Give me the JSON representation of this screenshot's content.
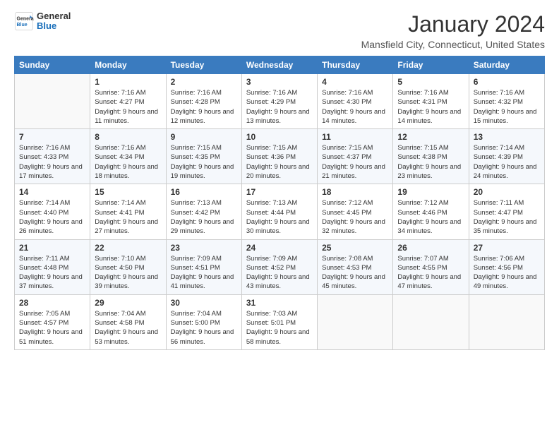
{
  "header": {
    "logo_general": "General",
    "logo_blue": "Blue",
    "month_title": "January 2024",
    "location": "Mansfield City, Connecticut, United States"
  },
  "days_of_week": [
    "Sunday",
    "Monday",
    "Tuesday",
    "Wednesday",
    "Thursday",
    "Friday",
    "Saturday"
  ],
  "weeks": [
    [
      {
        "day": "",
        "sunrise": "",
        "sunset": "",
        "daylight": ""
      },
      {
        "day": "1",
        "sunrise": "Sunrise: 7:16 AM",
        "sunset": "Sunset: 4:27 PM",
        "daylight": "Daylight: 9 hours and 11 minutes."
      },
      {
        "day": "2",
        "sunrise": "Sunrise: 7:16 AM",
        "sunset": "Sunset: 4:28 PM",
        "daylight": "Daylight: 9 hours and 12 minutes."
      },
      {
        "day": "3",
        "sunrise": "Sunrise: 7:16 AM",
        "sunset": "Sunset: 4:29 PM",
        "daylight": "Daylight: 9 hours and 13 minutes."
      },
      {
        "day": "4",
        "sunrise": "Sunrise: 7:16 AM",
        "sunset": "Sunset: 4:30 PM",
        "daylight": "Daylight: 9 hours and 14 minutes."
      },
      {
        "day": "5",
        "sunrise": "Sunrise: 7:16 AM",
        "sunset": "Sunset: 4:31 PM",
        "daylight": "Daylight: 9 hours and 14 minutes."
      },
      {
        "day": "6",
        "sunrise": "Sunrise: 7:16 AM",
        "sunset": "Sunset: 4:32 PM",
        "daylight": "Daylight: 9 hours and 15 minutes."
      }
    ],
    [
      {
        "day": "7",
        "sunrise": "Sunrise: 7:16 AM",
        "sunset": "Sunset: 4:33 PM",
        "daylight": "Daylight: 9 hours and 17 minutes."
      },
      {
        "day": "8",
        "sunrise": "Sunrise: 7:16 AM",
        "sunset": "Sunset: 4:34 PM",
        "daylight": "Daylight: 9 hours and 18 minutes."
      },
      {
        "day": "9",
        "sunrise": "Sunrise: 7:15 AM",
        "sunset": "Sunset: 4:35 PM",
        "daylight": "Daylight: 9 hours and 19 minutes."
      },
      {
        "day": "10",
        "sunrise": "Sunrise: 7:15 AM",
        "sunset": "Sunset: 4:36 PM",
        "daylight": "Daylight: 9 hours and 20 minutes."
      },
      {
        "day": "11",
        "sunrise": "Sunrise: 7:15 AM",
        "sunset": "Sunset: 4:37 PM",
        "daylight": "Daylight: 9 hours and 21 minutes."
      },
      {
        "day": "12",
        "sunrise": "Sunrise: 7:15 AM",
        "sunset": "Sunset: 4:38 PM",
        "daylight": "Daylight: 9 hours and 23 minutes."
      },
      {
        "day": "13",
        "sunrise": "Sunrise: 7:14 AM",
        "sunset": "Sunset: 4:39 PM",
        "daylight": "Daylight: 9 hours and 24 minutes."
      }
    ],
    [
      {
        "day": "14",
        "sunrise": "Sunrise: 7:14 AM",
        "sunset": "Sunset: 4:40 PM",
        "daylight": "Daylight: 9 hours and 26 minutes."
      },
      {
        "day": "15",
        "sunrise": "Sunrise: 7:14 AM",
        "sunset": "Sunset: 4:41 PM",
        "daylight": "Daylight: 9 hours and 27 minutes."
      },
      {
        "day": "16",
        "sunrise": "Sunrise: 7:13 AM",
        "sunset": "Sunset: 4:42 PM",
        "daylight": "Daylight: 9 hours and 29 minutes."
      },
      {
        "day": "17",
        "sunrise": "Sunrise: 7:13 AM",
        "sunset": "Sunset: 4:44 PM",
        "daylight": "Daylight: 9 hours and 30 minutes."
      },
      {
        "day": "18",
        "sunrise": "Sunrise: 7:12 AM",
        "sunset": "Sunset: 4:45 PM",
        "daylight": "Daylight: 9 hours and 32 minutes."
      },
      {
        "day": "19",
        "sunrise": "Sunrise: 7:12 AM",
        "sunset": "Sunset: 4:46 PM",
        "daylight": "Daylight: 9 hours and 34 minutes."
      },
      {
        "day": "20",
        "sunrise": "Sunrise: 7:11 AM",
        "sunset": "Sunset: 4:47 PM",
        "daylight": "Daylight: 9 hours and 35 minutes."
      }
    ],
    [
      {
        "day": "21",
        "sunrise": "Sunrise: 7:11 AM",
        "sunset": "Sunset: 4:48 PM",
        "daylight": "Daylight: 9 hours and 37 minutes."
      },
      {
        "day": "22",
        "sunrise": "Sunrise: 7:10 AM",
        "sunset": "Sunset: 4:50 PM",
        "daylight": "Daylight: 9 hours and 39 minutes."
      },
      {
        "day": "23",
        "sunrise": "Sunrise: 7:09 AM",
        "sunset": "Sunset: 4:51 PM",
        "daylight": "Daylight: 9 hours and 41 minutes."
      },
      {
        "day": "24",
        "sunrise": "Sunrise: 7:09 AM",
        "sunset": "Sunset: 4:52 PM",
        "daylight": "Daylight: 9 hours and 43 minutes."
      },
      {
        "day": "25",
        "sunrise": "Sunrise: 7:08 AM",
        "sunset": "Sunset: 4:53 PM",
        "daylight": "Daylight: 9 hours and 45 minutes."
      },
      {
        "day": "26",
        "sunrise": "Sunrise: 7:07 AM",
        "sunset": "Sunset: 4:55 PM",
        "daylight": "Daylight: 9 hours and 47 minutes."
      },
      {
        "day": "27",
        "sunrise": "Sunrise: 7:06 AM",
        "sunset": "Sunset: 4:56 PM",
        "daylight": "Daylight: 9 hours and 49 minutes."
      }
    ],
    [
      {
        "day": "28",
        "sunrise": "Sunrise: 7:05 AM",
        "sunset": "Sunset: 4:57 PM",
        "daylight": "Daylight: 9 hours and 51 minutes."
      },
      {
        "day": "29",
        "sunrise": "Sunrise: 7:04 AM",
        "sunset": "Sunset: 4:58 PM",
        "daylight": "Daylight: 9 hours and 53 minutes."
      },
      {
        "day": "30",
        "sunrise": "Sunrise: 7:04 AM",
        "sunset": "Sunset: 5:00 PM",
        "daylight": "Daylight: 9 hours and 56 minutes."
      },
      {
        "day": "31",
        "sunrise": "Sunrise: 7:03 AM",
        "sunset": "Sunset: 5:01 PM",
        "daylight": "Daylight: 9 hours and 58 minutes."
      },
      {
        "day": "",
        "sunrise": "",
        "sunset": "",
        "daylight": ""
      },
      {
        "day": "",
        "sunrise": "",
        "sunset": "",
        "daylight": ""
      },
      {
        "day": "",
        "sunrise": "",
        "sunset": "",
        "daylight": ""
      }
    ]
  ]
}
